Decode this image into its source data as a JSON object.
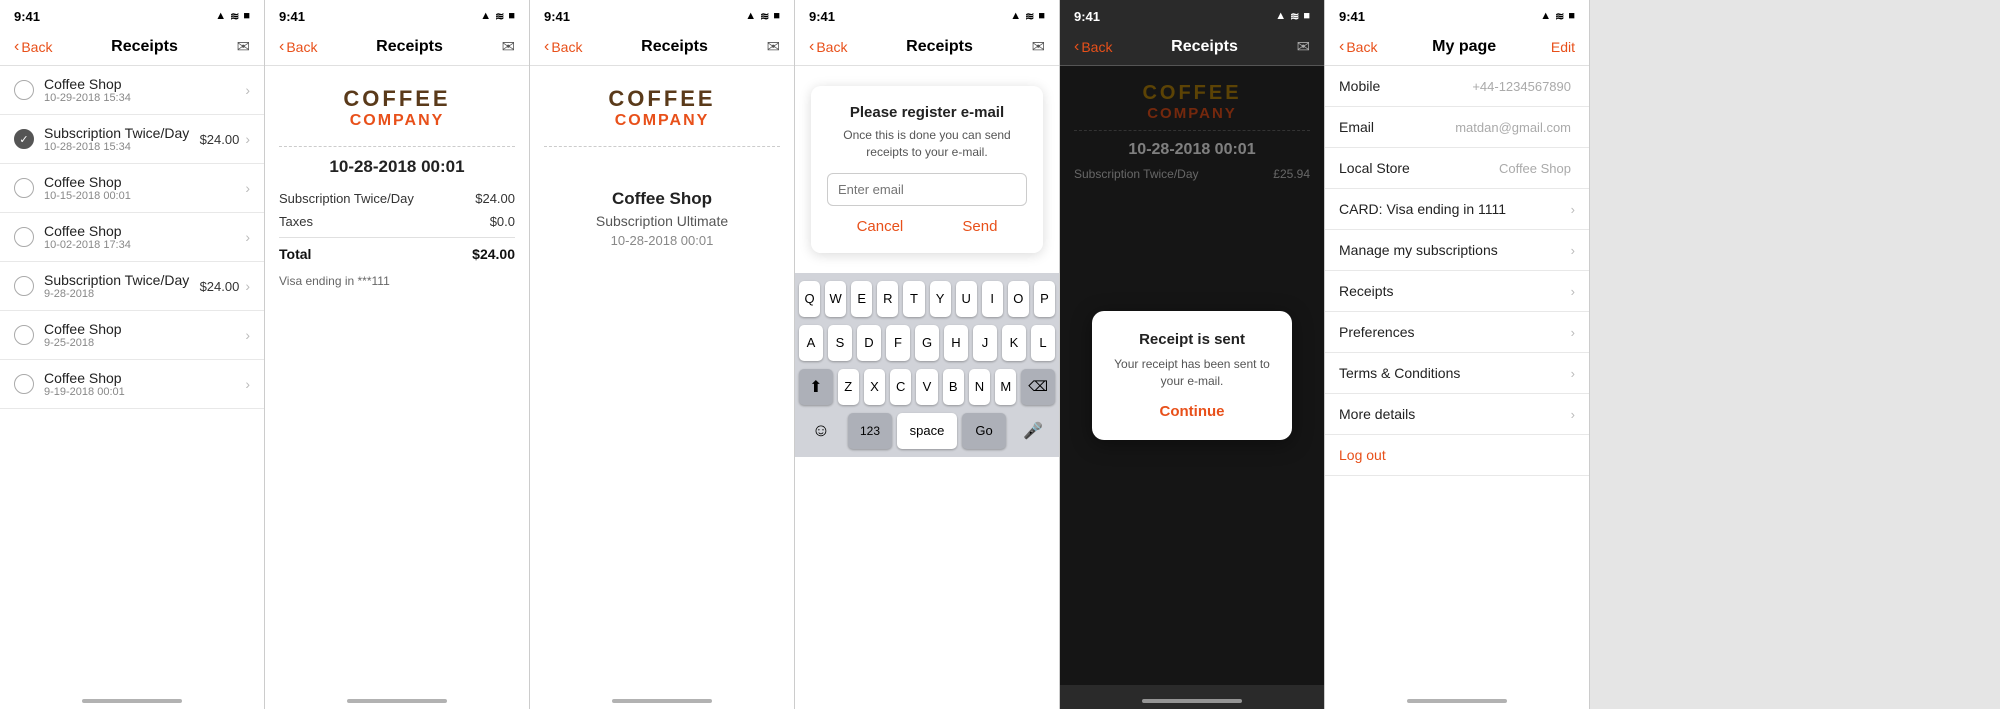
{
  "phones": [
    {
      "id": "phone1",
      "statusBar": {
        "time": "9:41",
        "icons": "▲ ≋ ■"
      },
      "nav": {
        "back": "Back",
        "title": "Receipts",
        "rightIcon": "✉"
      },
      "receipts": [
        {
          "name": "Coffee Shop",
          "date": "10-29-2018 15:34",
          "amount": "",
          "checked": false
        },
        {
          "name": "Subscription Twice/Day",
          "date": "10-28-2018 15:34",
          "amount": "$24.00",
          "checked": true
        },
        {
          "name": "Coffee Shop",
          "date": "10-15-2018 00:01",
          "amount": "",
          "checked": false
        },
        {
          "name": "Coffee Shop",
          "date": "10-02-2018 17:34",
          "amount": "",
          "checked": false
        },
        {
          "name": "Subscription Twice/Day",
          "date": "9-28-2018",
          "amount": "$24.00",
          "checked": false
        },
        {
          "name": "Coffee Shop",
          "date": "9-25-2018",
          "amount": "",
          "checked": false
        },
        {
          "name": "Coffee Shop",
          "date": "9-19-2018 00:01",
          "amount": "",
          "checked": false
        }
      ]
    },
    {
      "id": "phone2",
      "statusBar": {
        "time": "9:41",
        "icons": "▲ ≋ ■"
      },
      "nav": {
        "back": "Back",
        "title": "Receipts",
        "rightIcon": "✉"
      },
      "logoTop": "COFFEE",
      "logoBottom": "COMPANY",
      "receiptDate": "10-28-2018 00:01",
      "receiptRows": [
        {
          "label": "Subscription Twice/Day",
          "value": "$24.00"
        },
        {
          "label": "Taxes",
          "value": "$0.0"
        }
      ],
      "totalLabel": "Total",
      "totalValue": "$24.00",
      "cardText": "Visa ending in ***111"
    },
    {
      "id": "phone3",
      "statusBar": {
        "time": "9:41",
        "icons": "▲ ≋ ■"
      },
      "nav": {
        "back": "Back",
        "title": "Receipts",
        "rightIcon": "✉"
      },
      "logoTop": "COFFEE",
      "logoBottom": "COMPANY",
      "shopName": "Coffee Shop",
      "shopSub": "Subscription Ultimate",
      "shopDate": "10-28-2018 00:01"
    },
    {
      "id": "phone4",
      "statusBar": {
        "time": "9:41",
        "icons": "▲ ≋ ■"
      },
      "nav": {
        "back": "Back",
        "title": "Receipts",
        "rightIcon": "✉"
      },
      "dialog": {
        "title": "Please register e-mail",
        "text": "Once this is done you can send receipts to your e-mail.",
        "placeholder": "Enter email",
        "cancelLabel": "Cancel",
        "sendLabel": "Send"
      },
      "keyboard": {
        "row1": [
          "Q",
          "W",
          "E",
          "R",
          "T",
          "Y",
          "U",
          "I",
          "O",
          "P"
        ],
        "row2": [
          "A",
          "S",
          "D",
          "F",
          "G",
          "H",
          "J",
          "K",
          "L"
        ],
        "row3": [
          "Z",
          "X",
          "C",
          "V",
          "B",
          "N",
          "M"
        ],
        "bottomLeft": "123",
        "bottomMiddle": "space",
        "bottomRight": "Go"
      }
    },
    {
      "id": "phone5",
      "statusBar": {
        "time": "9:41",
        "icons": "▲ ≋ ■"
      },
      "nav": {
        "back": "Back",
        "title": "Receipts",
        "rightIcon": "✉"
      },
      "dark": true,
      "logoTop": "COFFEE",
      "logoBottom": "COMPANY",
      "receiptDate": "10-28-2018 00:01",
      "receiptRows": [
        {
          "label": "Subscription Twice/Day",
          "value": "£25.94"
        }
      ],
      "popup": {
        "title": "Receipt is sent",
        "text": "Your receipt has been sent to your e-mail.",
        "btnLabel": "Continue"
      }
    },
    {
      "id": "phone6",
      "statusBar": {
        "time": "9:41",
        "icons": "▲ ≋ ■"
      },
      "nav": {
        "back": "Back",
        "title": "My page",
        "rightLabel": "Edit"
      },
      "myPage": {
        "items": [
          {
            "label": "Mobile",
            "value": "+44-1234567890",
            "hasChevron": false
          },
          {
            "label": "Email",
            "value": "matdan@gmail.com",
            "hasChevron": false
          },
          {
            "label": "Local Store",
            "value": "Coffee Shop",
            "hasChevron": false
          },
          {
            "label": "CARD: Visa ending in 1111",
            "value": "",
            "hasChevron": true
          },
          {
            "label": "Manage my subscriptions",
            "value": "",
            "hasChevron": true
          },
          {
            "label": "Receipts",
            "value": "",
            "hasChevron": true
          },
          {
            "label": "Preferences",
            "value": "",
            "hasChevron": true
          },
          {
            "label": "Terms & Conditions",
            "value": "",
            "hasChevron": true
          },
          {
            "label": "More details",
            "value": "",
            "hasChevron": true
          },
          {
            "label": "Log out",
            "value": "",
            "hasChevron": false,
            "isLogout": true
          }
        ]
      }
    }
  ]
}
